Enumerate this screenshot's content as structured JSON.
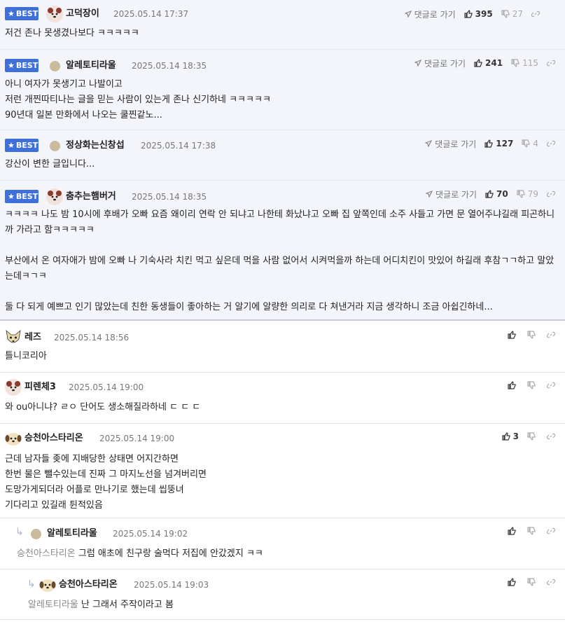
{
  "labels": {
    "best": "BEST",
    "reply": "댓글로 가기"
  },
  "comments": [
    {
      "author": "고덕장이",
      "date": "2025.05.14 17:37",
      "up": "395",
      "down": "27",
      "text": "저건 존나 못생겼나보다 ㅋㅋㅋㅋㅋ"
    },
    {
      "author": "알레토티라울",
      "date": "2025.05.14 18:35",
      "up": "241",
      "down": "115",
      "text": "아니 여자가 못생기고 나발이고\n저런 개찐따티나는 글을 믿는 사람이 있는게 존나 신기하네 ㅋㅋㅋㅋㅋ\n90년대 일본 만화에서 나오는 쿨찐같노..."
    },
    {
      "author": "정상화는신창섭",
      "date": "2025.05.14 17:38",
      "up": "127",
      "down": "4",
      "text": "강산이 변한 글입니다..."
    },
    {
      "author": "춤추는햄버거",
      "date": "2025.05.14 18:35",
      "up": "70",
      "down": "79",
      "text": "ㅋㅋㅋㅋ 나도 밤 10시에 후배가 오빠 요즘 왜이리 연락 안 되냐고 나한테 화났냐고 오빠 집 앞쪽인데 소주 사들고 가면 문 열어주냐길래 피곤하니까 가라고 함ㅋㅋㅋㅋㅋ\n\n부산에서 온 여자애가 밤에 오빠 나 기숙사라 치킨 먹고 싶은데 먹을 사람 없어서 시켜먹을까 하는데 어디치킨이 맛있어 하길래 후참ㄱㄱ하고 말았는데ㅋㄱㅋ\n\n둘 다 되게 예쁘고 인기 많았는데 친한 동생들이 좋아하는 거 알기에 알량한 의리로 다 쳐낸거라 지금 생각하니 조금 아쉽긴하네..."
    },
    {
      "author": "레즈",
      "date": "2025.05.14 18:56",
      "up": "",
      "text": "틀니코리아"
    },
    {
      "author": "피렌체3",
      "date": "2025.05.14 19:00",
      "up": "",
      "text": "와 ou아니냐? ㄹㅇ 단어도 생소해질라하네 ㄷ ㄷ ㄷ"
    },
    {
      "author": "승천아스타리온",
      "date": "2025.05.14 19:00",
      "up": "3",
      "text": "근데 남자들 좆에 지배당한 상태면 어지간하면\n한번 물은 뺄수있는데 진짜 그 마지노선을 넘겨버리면\n도망가게되더라 어플로 만나기로 했는데 씹뚱녀\n기다리고 있길래 튄적있음"
    },
    {
      "author": "알레토티라울",
      "date": "2025.05.14 19:02",
      "up": "",
      "mention": "승천아스타리온",
      "text": "그럼 애초에 친구랑 술먹다 저집에 안갔겠지 ㅋㅋ"
    },
    {
      "author": "승천아스타리온",
      "date": "2025.05.14 19:03",
      "up": "",
      "mention": "알레토티라울",
      "text": "난 그래서 주작이라고 봄"
    }
  ],
  "colors": {
    "best_badge": "#3f6fd8",
    "best_bg": "#f3f5fb"
  }
}
